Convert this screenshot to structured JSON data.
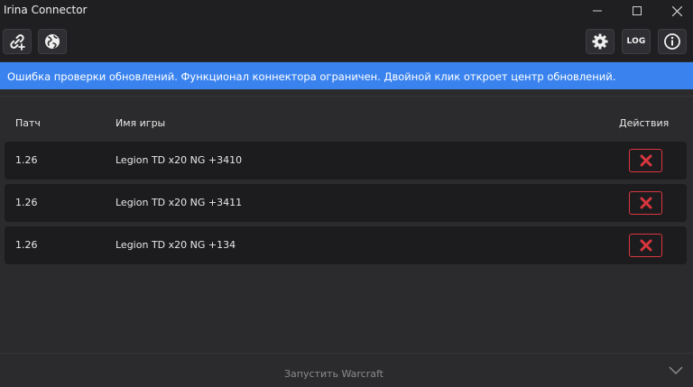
{
  "window": {
    "title": "Irina Connector",
    "controls": {
      "minimize": "—",
      "maximize": "☐",
      "close": "✕"
    }
  },
  "toolbar": {
    "left": [
      {
        "icon": "link-add-icon",
        "name": "add-link-button"
      },
      {
        "icon": "globe-icon",
        "name": "globe-button"
      }
    ],
    "right": [
      {
        "icon": "gear-icon",
        "name": "settings-button"
      },
      {
        "label": "LOG",
        "name": "log-button"
      },
      {
        "icon": "info-icon",
        "name": "info-button"
      }
    ]
  },
  "banner": {
    "text": "Ошибка проверки обновлений. Функционал коннектора ограничен. Двойной клик откроет центр обновлений.",
    "color": "#3a83ef"
  },
  "table": {
    "headers": {
      "patch": "Патч",
      "game": "Имя игры",
      "actions": "Действия"
    },
    "rows": [
      {
        "patch": "1.26",
        "game": "Legion TD x20 NG +3410"
      },
      {
        "patch": "1.26",
        "game": "Legion TD x20 NG +3411"
      },
      {
        "patch": "1.26",
        "game": "Legion TD x20 NG +134"
      }
    ],
    "delete_icon": "close-x-icon",
    "delete_color": "#d9363e"
  },
  "footer": {
    "launch_label": "Запустить Warcraft",
    "chevron_icon": "chevron-down-icon"
  }
}
